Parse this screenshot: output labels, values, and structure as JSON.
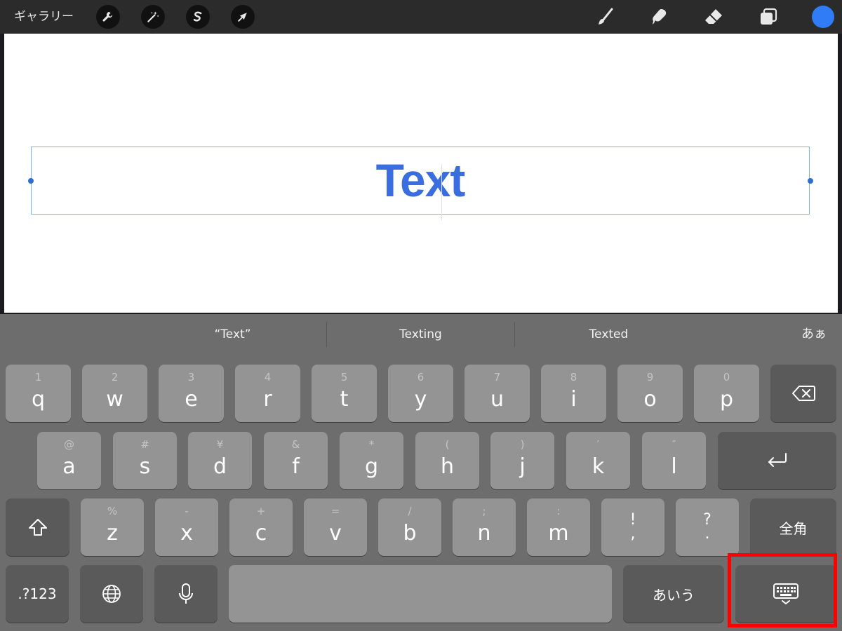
{
  "toolbar": {
    "gallery_label": "ギャラリー",
    "left_tools": [
      "wrench-icon",
      "magic-wand-icon",
      "selection-s-icon",
      "transform-arrow-icon"
    ],
    "right_tools": [
      "brush-icon",
      "smudge-icon",
      "eraser-icon",
      "layers-icon"
    ],
    "color_swatch": "#2f7cf6"
  },
  "canvas": {
    "text": "Text",
    "text_color": "#3a6de0",
    "box_border_color": "#7eb4e6"
  },
  "keyboard": {
    "suggestions": [
      "“Text”",
      "Texting",
      "Texted"
    ],
    "kana_switch": "あぁ",
    "row1": [
      {
        "hint": "1",
        "key": "q"
      },
      {
        "hint": "2",
        "key": "w"
      },
      {
        "hint": "3",
        "key": "e"
      },
      {
        "hint": "4",
        "key": "r"
      },
      {
        "hint": "5",
        "key": "t"
      },
      {
        "hint": "6",
        "key": "y"
      },
      {
        "hint": "7",
        "key": "u"
      },
      {
        "hint": "8",
        "key": "i"
      },
      {
        "hint": "9",
        "key": "o"
      },
      {
        "hint": "0",
        "key": "p"
      }
    ],
    "row2": [
      {
        "hint": "@",
        "key": "a"
      },
      {
        "hint": "#",
        "key": "s"
      },
      {
        "hint": "¥",
        "key": "d"
      },
      {
        "hint": "&",
        "key": "f"
      },
      {
        "hint": "*",
        "key": "g"
      },
      {
        "hint": "(",
        "key": "h"
      },
      {
        "hint": ")",
        "key": "j"
      },
      {
        "hint": "′",
        "key": "k"
      },
      {
        "hint": "″",
        "key": "l"
      }
    ],
    "row3": [
      {
        "hint": "%",
        "key": "z"
      },
      {
        "hint": "-",
        "key": "x"
      },
      {
        "hint": "+",
        "key": "c"
      },
      {
        "hint": "=",
        "key": "v"
      },
      {
        "hint": "/",
        "key": "b"
      },
      {
        "hint": ";",
        "key": "n"
      },
      {
        "hint": ":",
        "key": "m"
      }
    ],
    "punct_excl": {
      "top": "!",
      "bottom": ","
    },
    "punct_q": {
      "top": "?",
      "bottom": "."
    },
    "zenkaku_label": "全角",
    "numbers_label": ".?123",
    "hiragana_label": "あいう",
    "highlight_color": "#ff0000"
  }
}
